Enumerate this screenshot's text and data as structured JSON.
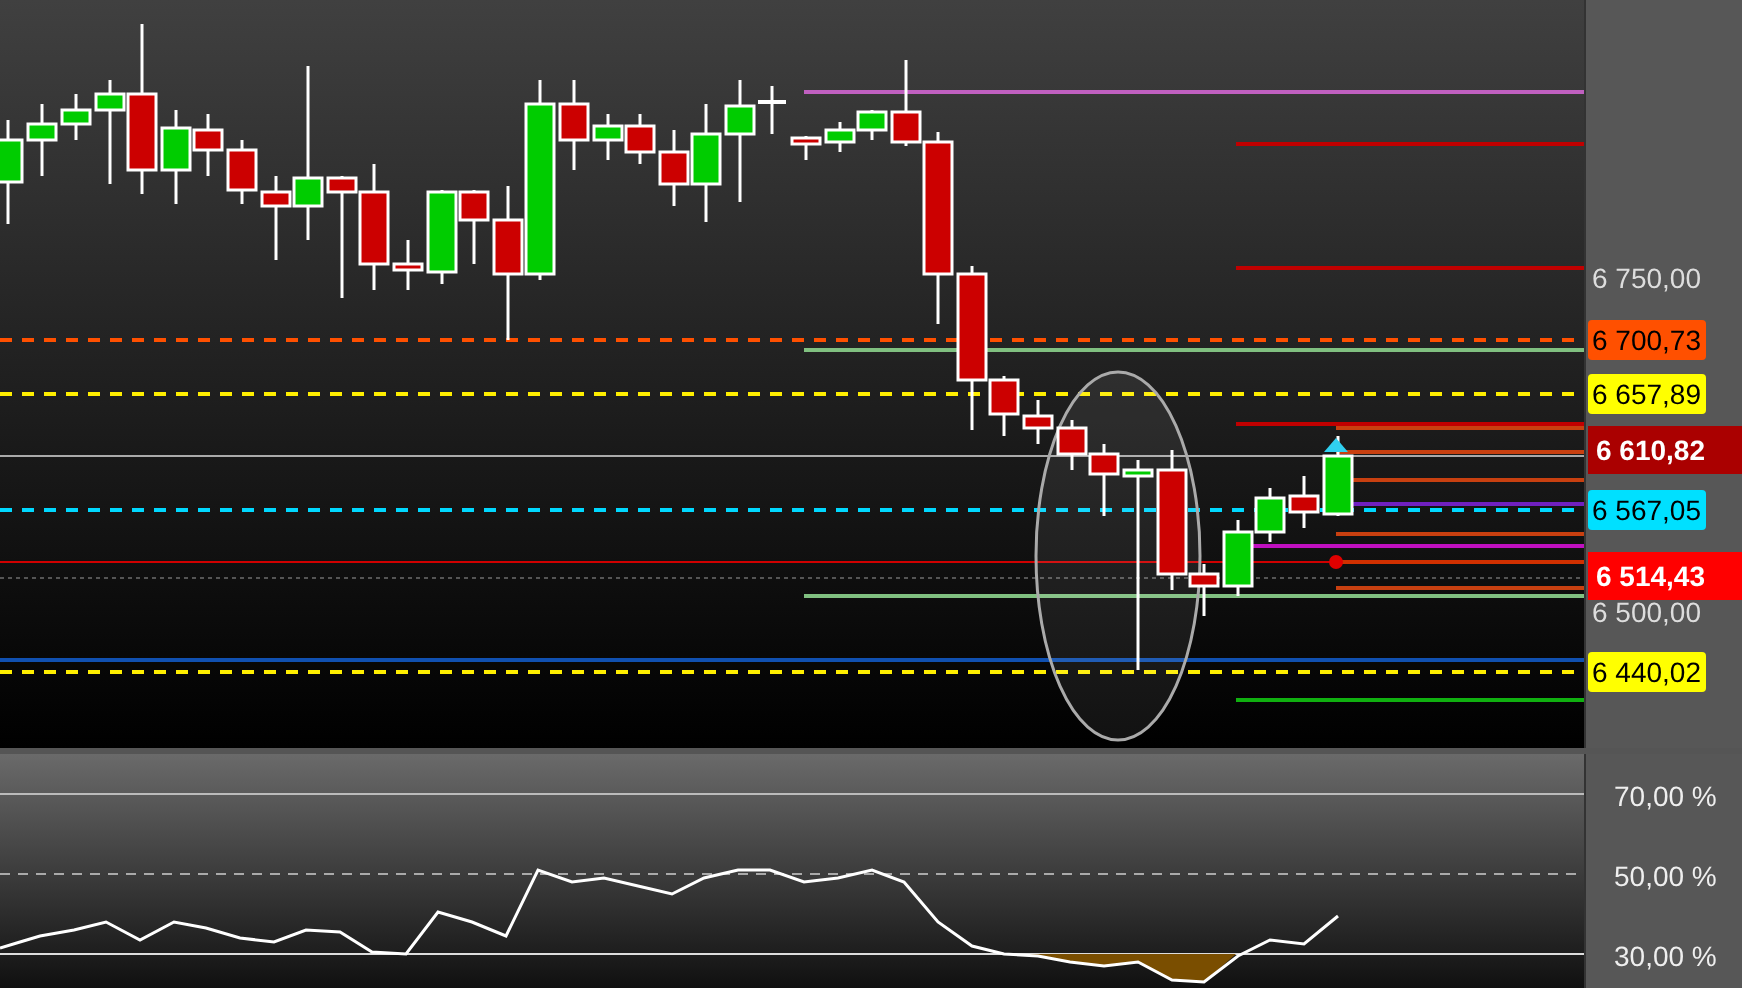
{
  "price_axis": {
    "labels": [
      {
        "text": "6 750,00",
        "kind": "tick"
      },
      {
        "text": "6 700,73",
        "kind": "level",
        "color": "#ff5000"
      },
      {
        "text": "6 657,89",
        "kind": "level",
        "color": "#ffff00"
      },
      {
        "text": "6 610,82",
        "kind": "price",
        "color": "#aa0000"
      },
      {
        "text": "6 567,05",
        "kind": "level",
        "color": "#00e0ff"
      },
      {
        "text": "6 514,43",
        "kind": "price",
        "color": "#ff0000"
      },
      {
        "text": "6 500,00",
        "kind": "tick"
      },
      {
        "text": "6 440,02",
        "kind": "level",
        "color": "#ffff00"
      }
    ]
  },
  "oscillator_axis": {
    "labels": [
      {
        "text": "70,00 %"
      },
      {
        "text": "50,00 %"
      },
      {
        "text": "30,00 %"
      }
    ]
  }
}
